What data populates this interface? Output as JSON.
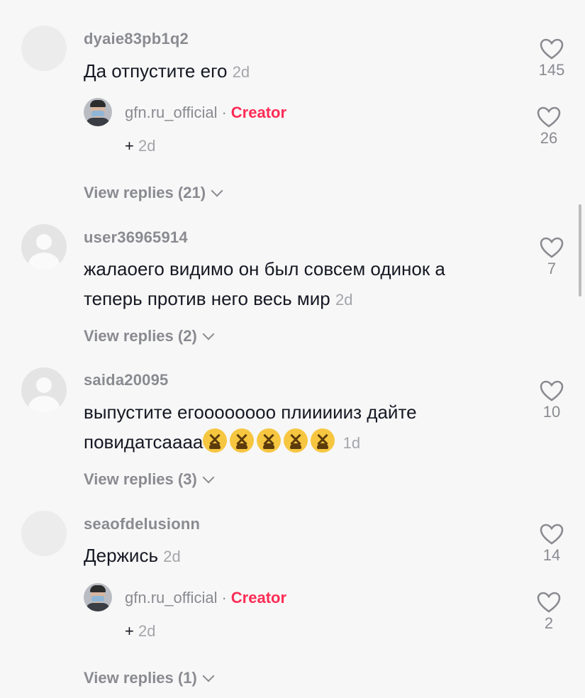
{
  "comments": [
    {
      "username": "dyaie83pb1q2",
      "text": "Да отпустите его",
      "time": "2d",
      "likes": "145",
      "reply": {
        "name": "gfn.ru_official",
        "badge": "Creator",
        "text": "+",
        "time": "2d",
        "likes": "26"
      },
      "view_replies": "View replies (21)"
    },
    {
      "username": "user36965914",
      "text_line1": "жалаоего видимо он был совсем одинок а",
      "text_line2": "теперь против него весь мир",
      "time": "2d",
      "likes": "7",
      "view_replies": "View replies (2)"
    },
    {
      "username": "saida20095",
      "text_line1": "выпустите егоооооооо плиииииз дайте",
      "text_line2": "повидатсаааа",
      "time": "1d",
      "likes": "10",
      "emoji_count": 5,
      "emoji_name": "tired-face-emoji",
      "view_replies": "View replies (3)"
    },
    {
      "username": "seaofdelusionn",
      "text": "Держись",
      "time": "2d",
      "likes": "14",
      "reply": {
        "name": "gfn.ru_official",
        "badge": "Creator",
        "text": "+",
        "time": "2d",
        "likes": "2"
      },
      "view_replies": "View replies (1)"
    }
  ],
  "colors": {
    "creator": "#fe2c55",
    "muted": "#8a8b91",
    "text": "#161823",
    "background": "#f7f7f7"
  }
}
